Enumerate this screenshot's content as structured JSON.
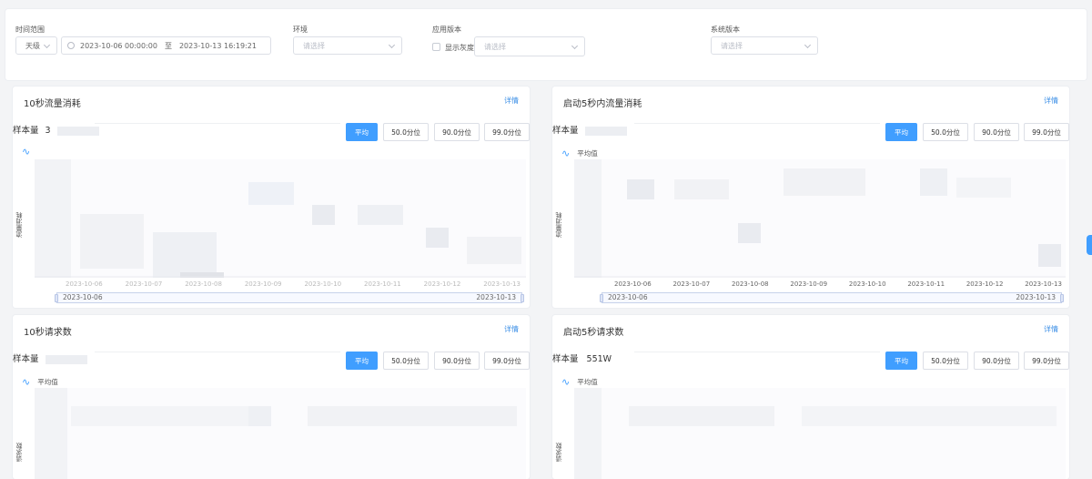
{
  "filters": {
    "time_range_label": "时间范围",
    "unit_value": "天级",
    "start_time": "2023-10-06 00:00:00",
    "range_sep": "至",
    "end_time": "2023-10-13 16:19:21",
    "env_label": "环境",
    "env_placeholder": "请选择",
    "app_version_label": "应用版本",
    "show_gray_label": "显示灰度",
    "app_version_placeholder": "请选择",
    "sys_version_label": "系统版本",
    "sys_version_placeholder": "请选择"
  },
  "cards": [
    {
      "title": "10秒流量消耗",
      "detail": "详情",
      "sample_label": "样本量",
      "sample_value": "3",
      "buttons": [
        "平均",
        "50.0分位",
        "90.0分位",
        "99.0分位"
      ],
      "legend": "",
      "ylabel": "流量消耗",
      "xticks": [
        "2023-10-06",
        "2023-10-07",
        "2023-10-08",
        "2023-10-09",
        "2023-10-10",
        "2023-10-11",
        "2023-10-12",
        "2023-10-13"
      ],
      "slider_start": "2023-10-06",
      "slider_end": "2023-10-13"
    },
    {
      "title": "启动5秒内流量消耗",
      "detail": "详情",
      "sample_label": "样本量",
      "sample_value": "",
      "buttons": [
        "平均",
        "50.0分位",
        "90.0分位",
        "99.0分位"
      ],
      "legend": "平均值",
      "ylabel": "流量消耗",
      "xticks": [
        "2023-10-06",
        "2023-10-07",
        "2023-10-08",
        "2023-10-09",
        "2023-10-10",
        "2023-10-11",
        "2023-10-12",
        "2023-10-13"
      ],
      "slider_start": "2023-10-06",
      "slider_end": "2023-10-13"
    },
    {
      "title": "10秒请求数",
      "detail": "详情",
      "sample_label": "样本量",
      "sample_value": "",
      "buttons": [
        "平均",
        "50.0分位",
        "90.0分位",
        "99.0分位"
      ],
      "legend": "平均值",
      "ylabel": "请求数"
    },
    {
      "title": "启动5秒请求数",
      "detail": "详情",
      "sample_label": "样本量",
      "sample_value": "551W",
      "buttons": [
        "平均",
        "50.0分位",
        "90.0分位",
        "99.0分位"
      ],
      "legend": "平均值",
      "ylabel": "请求数"
    }
  ],
  "colors": {
    "accent": "#409eff",
    "link": "#3a8ee6",
    "panel": "#ffffff",
    "background": "#f3f4f6"
  },
  "icons": [
    "clock-icon",
    "chevron-down-icon",
    "wave-legend-icon"
  ]
}
